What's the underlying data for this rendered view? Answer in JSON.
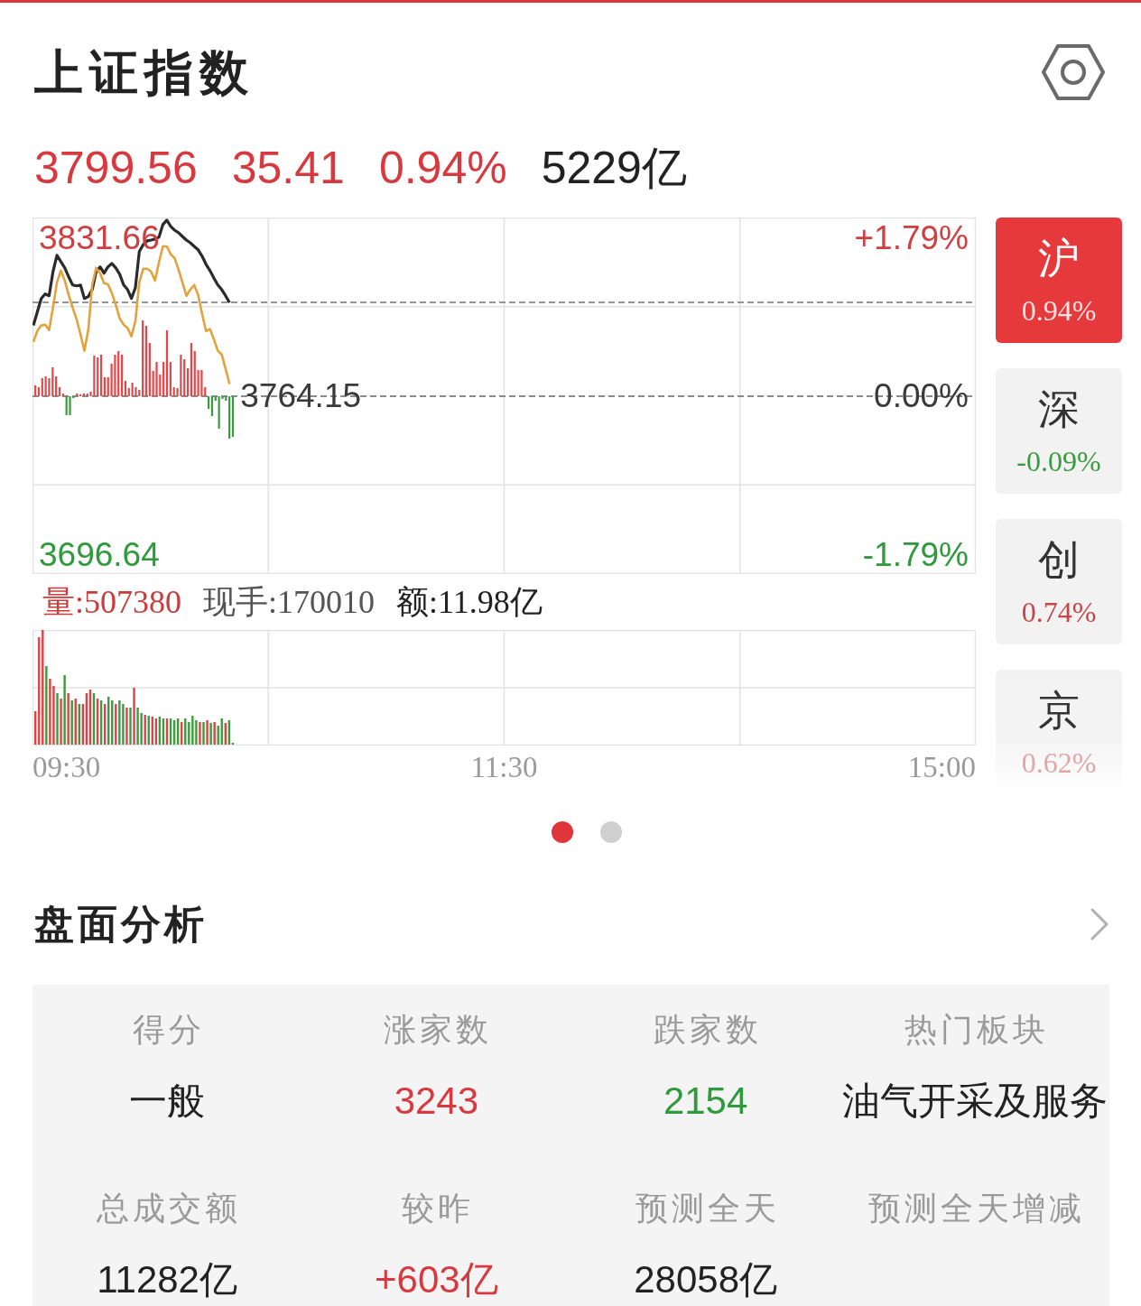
{
  "header": {
    "title": "上证指数"
  },
  "quote": [
    {
      "text": "3799.56",
      "color": "#d8393e"
    },
    {
      "text": "35.41",
      "color": "#d8393e"
    },
    {
      "text": "0.94%",
      "color": "#d8393e"
    },
    {
      "text": "5229亿",
      "color": "#222222"
    }
  ],
  "price_chart": {
    "price_labels": [
      {
        "label": "3831.66",
        "color": "#cf3f42"
      },
      {
        "label": "3764.15",
        "color": "#3a3a3a"
      },
      {
        "label": "3696.64",
        "color": "#2f9a3b"
      }
    ],
    "percent_labels": [
      {
        "label": "+1.79%",
        "color": "#cf3f42"
      },
      {
        "label": "0.00%",
        "color": "#3a3a3a"
      },
      {
        "label": "-1.79%",
        "color": "#2f9a3b"
      }
    ]
  },
  "volume_info": {
    "volume": "量:507380",
    "last_trade": "现手:170010",
    "amount": "额:11.98亿"
  },
  "time_labels": [
    "09:30",
    "11:30",
    "15:00"
  ],
  "markets": [
    {
      "name": "沪",
      "change": "0.94%",
      "color": "#ffe4e4",
      "selected": true
    },
    {
      "name": "深",
      "change": "-0.09%",
      "color": "#3a9a3e",
      "selected": false
    },
    {
      "name": "创",
      "change": "0.74%",
      "color": "#c84448",
      "selected": false
    },
    {
      "name": "京",
      "change": "0.62%",
      "color": "#e3a5a7",
      "selected": false
    }
  ],
  "pager": [
    {
      "selected": true
    },
    {
      "selected": false
    }
  ],
  "analysis": {
    "title": "盘面分析",
    "stats": [
      {
        "label": "得分",
        "value": "一般",
        "color": "#222222"
      },
      {
        "label": "涨家数",
        "value": "3243",
        "color": "#d8393e"
      },
      {
        "label": "跌家数",
        "value": "2154",
        "color": "#2f9a3b"
      },
      {
        "label": "热门板块",
        "value": "油气开采及服务",
        "color": "#222222"
      },
      {
        "label": "总成交额",
        "value": "11282亿",
        "color": "#222222"
      },
      {
        "label": "较昨",
        "value": "+603亿",
        "color": "#d8393e"
      },
      {
        "label": "预测全天",
        "value": "28058亿",
        "color": "#222222"
      },
      {
        "label": "预测全天增减"
      }
    ]
  }
}
